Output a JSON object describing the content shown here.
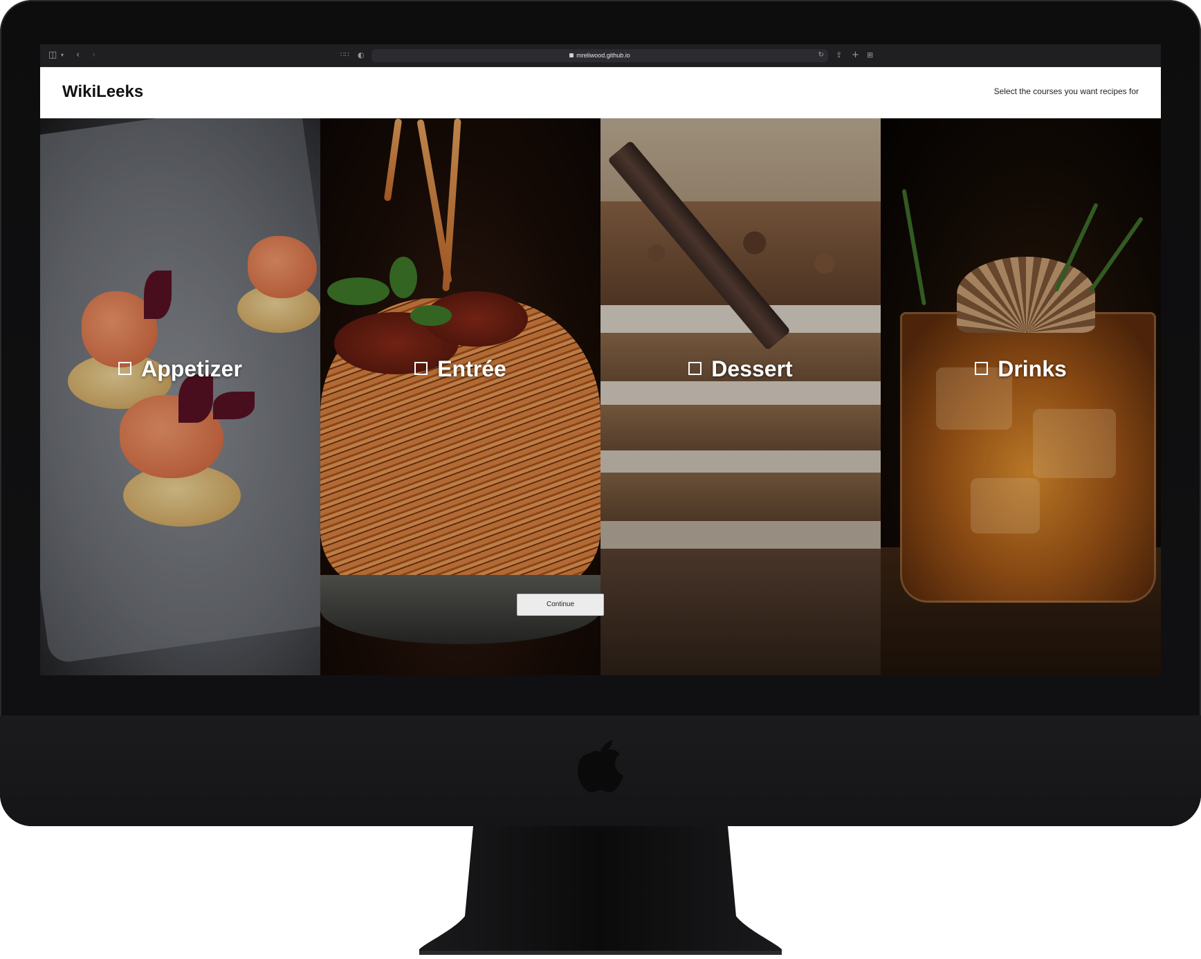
{
  "browser": {
    "url": "mreliwood.github.io",
    "icons": [
      "sidebar-icon",
      "chevron-down-icon",
      "back-icon",
      "forward-icon",
      "grid-icon",
      "shield-icon",
      "lock-icon",
      "reload-icon",
      "share-icon",
      "new-tab-icon",
      "tab-overview-icon"
    ]
  },
  "header": {
    "brand": "WikiLeeks",
    "tagline": "Select the courses you want recipes for"
  },
  "courses": [
    {
      "label": "Appetizer",
      "checked": false
    },
    {
      "label": "Entrée",
      "checked": false
    },
    {
      "label": "Dessert",
      "checked": false
    },
    {
      "label": "Drinks",
      "checked": false
    }
  ],
  "continue_label": "Continue",
  "colors": {
    "header_bg": "#ffffff",
    "button_bg": "#ececec",
    "label_color": "#ffffff",
    "device_frame": "#111113"
  }
}
